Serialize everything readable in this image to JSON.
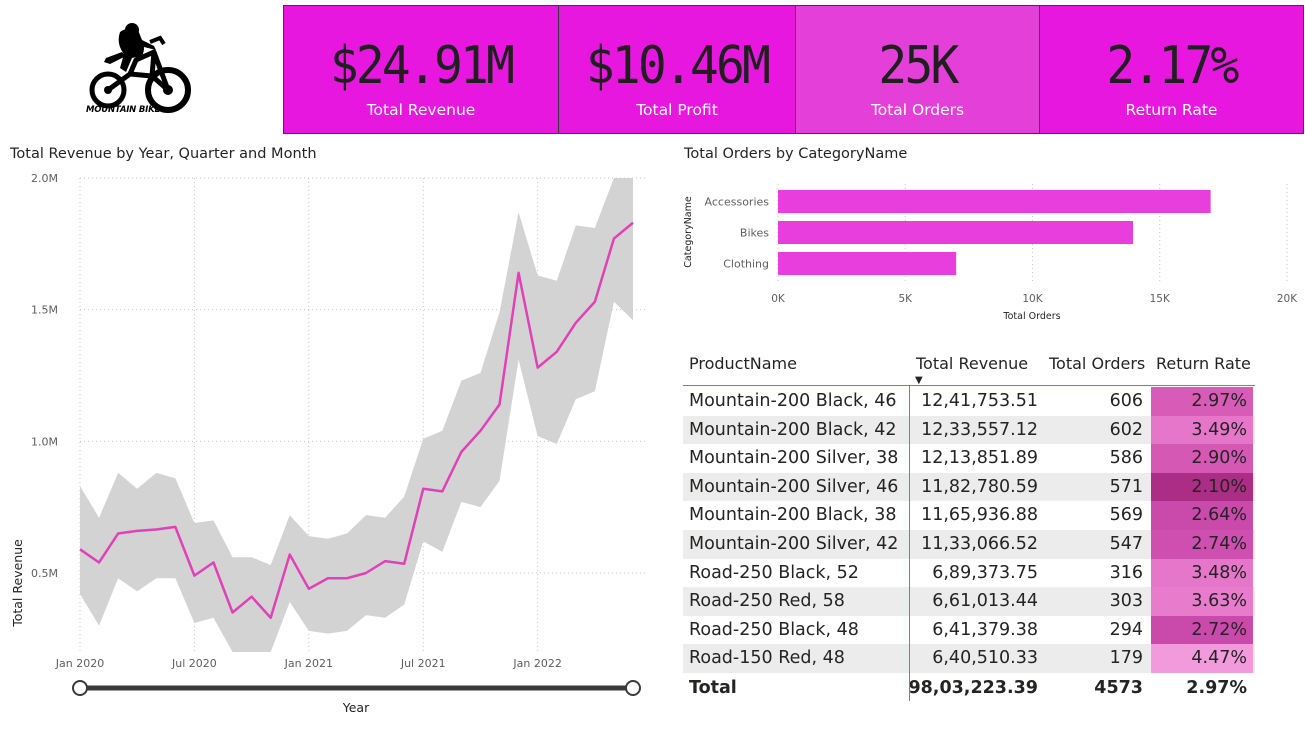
{
  "logo": {
    "text": "MOUNTAIN BIKE"
  },
  "kpis": [
    {
      "value": "$24.91M",
      "label": "Total Revenue"
    },
    {
      "value": "$10.46M",
      "label": "Total Profit"
    },
    {
      "value": "25K",
      "label": "Total Orders"
    },
    {
      "value": "2.17%",
      "label": "Return Rate"
    }
  ],
  "colors": {
    "kpi_bg": "#e817e0",
    "accent_line": "#e040b8",
    "bar": "#e83ede",
    "band": "#d3d3d3",
    "table_rule": "#3a97c4"
  },
  "line_chart": {
    "title": "Total Revenue by Year, Quarter and Month"
  },
  "bar_chart": {
    "title": "Total Orders by CategoryName"
  },
  "table": {
    "headers": [
      "ProductName",
      "Total Revenue",
      "Total Orders",
      "Return Rate"
    ],
    "sort_indicator": "▼",
    "rows": [
      {
        "name": "Mountain-200 Black, 46",
        "revenue": "12,41,753.51",
        "orders": "606",
        "rate": "2.97%",
        "shade": "#d95bb8"
      },
      {
        "name": "Mountain-200 Black, 42",
        "revenue": "12,33,557.12",
        "orders": "602",
        "rate": "3.49%",
        "shade": "#e676c9"
      },
      {
        "name": "Mountain-200 Silver, 38",
        "revenue": "12,13,851.89",
        "orders": "586",
        "rate": "2.90%",
        "shade": "#d558b5"
      },
      {
        "name": "Mountain-200 Silver, 46",
        "revenue": "11,82,780.59",
        "orders": "571",
        "rate": "2.10%",
        "shade": "#ac2d86"
      },
      {
        "name": "Mountain-200 Black, 38",
        "revenue": "11,65,936.88",
        "orders": "569",
        "rate": "2.64%",
        "shade": "#c94aaa"
      },
      {
        "name": "Mountain-200 Silver, 42",
        "revenue": "11,33,066.52",
        "orders": "547",
        "rate": "2.74%",
        "shade": "#cf4fb0"
      },
      {
        "name": "Road-250 Black, 52",
        "revenue": "6,89,373.75",
        "orders": "316",
        "rate": "3.48%",
        "shade": "#e676c9"
      },
      {
        "name": "Road-250 Red, 58",
        "revenue": "6,61,013.44",
        "orders": "303",
        "rate": "3.63%",
        "shade": "#e97bcd"
      },
      {
        "name": "Road-250 Black, 48",
        "revenue": "6,41,379.38",
        "orders": "294",
        "rate": "2.72%",
        "shade": "#c94aaa"
      },
      {
        "name": "Road-150 Red, 48",
        "revenue": "6,40,510.33",
        "orders": "179",
        "rate": "4.47%",
        "shade": "#f29bdc"
      }
    ],
    "total": {
      "label": "Total",
      "revenue": "98,03,223.39",
      "orders": "4573",
      "rate": "2.97%"
    }
  },
  "chart_data": [
    {
      "type": "line",
      "title": "Total Revenue by Year, Quarter and Month",
      "xlabel": "Year",
      "ylabel": "Total Revenue",
      "ylim": [
        0.2,
        2.0
      ],
      "y_unit": "M",
      "yticks": [
        "0.5M",
        "1.0M",
        "1.5M",
        "2.0M"
      ],
      "xticks": [
        "Jan 2020",
        "Jul 2020",
        "Jan 2021",
        "Jul 2021",
        "Jan 2022"
      ],
      "x": [
        "2020-01",
        "2020-02",
        "2020-03",
        "2020-04",
        "2020-05",
        "2020-06",
        "2020-07",
        "2020-08",
        "2020-09",
        "2020-10",
        "2020-11",
        "2020-12",
        "2021-01",
        "2021-02",
        "2021-03",
        "2021-04",
        "2021-05",
        "2021-06",
        "2021-07",
        "2021-08",
        "2021-09",
        "2021-10",
        "2021-11",
        "2021-12",
        "2022-01",
        "2022-02",
        "2022-03",
        "2022-04",
        "2022-05",
        "2022-06"
      ],
      "series": [
        {
          "values": [
            0.59,
            0.54,
            0.65,
            0.66,
            0.665,
            0.675,
            0.49,
            0.54,
            0.35,
            0.41,
            0.33,
            0.57,
            0.44,
            0.48,
            0.48,
            0.5,
            0.545,
            0.535,
            0.82,
            0.81,
            0.96,
            1.04,
            1.14,
            1.64,
            1.28,
            1.34,
            1.45,
            1.53,
            1.77,
            1.83
          ]
        }
      ],
      "band_upper": [
        0.83,
        0.71,
        0.88,
        0.82,
        0.88,
        0.86,
        0.69,
        0.7,
        0.56,
        0.56,
        0.53,
        0.72,
        0.64,
        0.63,
        0.65,
        0.72,
        0.71,
        0.79,
        1.01,
        1.04,
        1.23,
        1.26,
        1.49,
        1.87,
        1.63,
        1.61,
        1.82,
        1.81,
        2.0,
        2.0
      ],
      "band_lower": [
        0.42,
        0.3,
        0.48,
        0.43,
        0.48,
        0.48,
        0.31,
        0.33,
        0.2,
        0.2,
        0.2,
        0.39,
        0.28,
        0.27,
        0.28,
        0.34,
        0.33,
        0.38,
        0.62,
        0.58,
        0.77,
        0.75,
        0.85,
        1.31,
        1.02,
        0.99,
        1.16,
        1.19,
        1.53,
        1.46
      ],
      "grid": true,
      "range_slider": true
    },
    {
      "type": "bar",
      "orientation": "horizontal",
      "title": "Total Orders by CategoryName",
      "xlabel": "Total Orders",
      "ylabel": "CategoryName",
      "categories": [
        "Accessories",
        "Bikes",
        "Clothing"
      ],
      "values": [
        17000,
        13950,
        7000
      ],
      "xlim": [
        0,
        20000
      ],
      "xticks": [
        "0K",
        "5K",
        "10K",
        "15K",
        "20K"
      ],
      "grid": true
    }
  ]
}
